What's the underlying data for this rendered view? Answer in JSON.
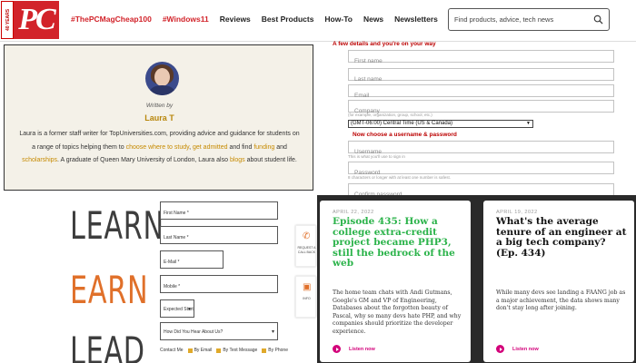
{
  "header": {
    "logo_years": "40 YEARS",
    "logo_text": "PC",
    "nav": [
      {
        "label": "#ThePCMagCheap100",
        "accent": true
      },
      {
        "label": "#Windows11",
        "accent": true
      },
      {
        "label": "Reviews",
        "accent": false
      },
      {
        "label": "Best Products",
        "accent": false
      },
      {
        "label": "How-To",
        "accent": false
      },
      {
        "label": "News",
        "accent": false
      },
      {
        "label": "Newsletters",
        "accent": false
      }
    ],
    "search_placeholder": "Find products, advice, tech news"
  },
  "author": {
    "written_by": "Written by",
    "name": "Laura T",
    "bio_parts": [
      {
        "text": "Laura is a former staff writer for TopUniversities.com, providing advice and guidance for students on a range of topics helping them to ",
        "link": false
      },
      {
        "text": "choose where to study",
        "link": true
      },
      {
        "text": ", ",
        "link": false
      },
      {
        "text": "get admitted",
        "link": true
      },
      {
        "text": " and find ",
        "link": false
      },
      {
        "text": "funding",
        "link": true
      },
      {
        "text": " and ",
        "link": false
      },
      {
        "text": "scholarships",
        "link": true
      },
      {
        "text": ". A graduate of Queen Mary University of London, Laura also ",
        "link": false
      },
      {
        "text": "blogs",
        "link": true
      },
      {
        "text": " about student life.",
        "link": false
      }
    ]
  },
  "signup": {
    "heading1": "A few details and you're on your way",
    "first_name": "First name",
    "last_name": "Last name",
    "email": "Email",
    "company": "Company",
    "company_hint": "(for example, organization, group, school, etc.)",
    "timezone": "(GMT-06:00) Central Time (US & Canada)",
    "heading2": "Now choose a username & password",
    "username": "Username",
    "username_hint": "This is what you'll use to sign in",
    "password": "Password",
    "password_hint": "8 characters or longer with at least one number is safest.",
    "confirm_password": "Confirm password"
  },
  "promo": {
    "words": [
      "LEARN",
      "EARN",
      "LEAD"
    ],
    "colors": {
      "dark": "#3d3d3d",
      "orange": "#e0702a"
    }
  },
  "leadform": {
    "first_name": "First Name *",
    "last_name": "Last Name *",
    "email": "E-Mail *",
    "mobile": "Mobile *",
    "expected_start": "Expected Start *",
    "heard_about": "How Did You Hear About Us?",
    "contact_by": "Contact Me",
    "contact_options": [
      "By Email",
      "By Text Message",
      "By Phone"
    ]
  },
  "side_widget": [
    {
      "icon": "phone-icon",
      "label": "REQUEST A CALL BACK"
    },
    {
      "icon": "info-icon",
      "label": "INFO"
    }
  ],
  "podcasts": [
    {
      "date": "APRIL 22, 2022",
      "title": "Episode 435: How a college extra-credit project became PHP3, still the bedrock of the web",
      "title_color": "#2bb34a",
      "description": "The home team chats with Andi Gutmans, Google's GM and VP of Engineering, Databases about the forgotten beauty of Pascal, why so many devs hate PHP, and why companies should prioritize the developer experience.",
      "listen": "Listen now"
    },
    {
      "date": "APRIL 19, 2022",
      "title": "What's the average tenure of an engineer at a big tech company? (Ep. 434)",
      "title_color": "#111111",
      "description": "While many devs see landing a FAANG job as a major achievement, the data shows many don't stay long after joining.",
      "listen": "Listen now"
    }
  ]
}
